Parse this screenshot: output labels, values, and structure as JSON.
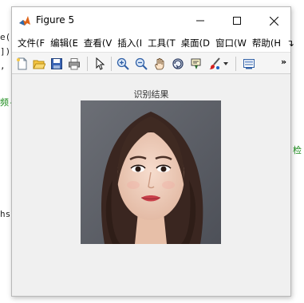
{
  "background_editor": {
    "lines": [
      "e(",
      "]);",
      ",",
      "频-识",
      "hs",
      "检"
    ]
  },
  "window": {
    "title": "Figure 5",
    "buttons": {
      "minimize": "—",
      "maximize": "☐",
      "close": "✕"
    }
  },
  "menu": {
    "items": [
      "文件(F",
      "编辑(E",
      "查看(V",
      "插入(I",
      "工具(T",
      "桌面(D",
      "窗口(W",
      "帮助(H",
      "↴"
    ]
  },
  "toolbar": {
    "more": "»",
    "icons": [
      "new-figure-icon",
      "open-file-icon",
      "save-icon",
      "print-icon",
      "pointer-icon",
      "zoom-in-icon",
      "zoom-out-icon",
      "pan-hand-icon",
      "rotate-3d-icon",
      "data-cursor-icon",
      "brush-icon",
      "brush-dropdown-icon",
      "link-plot-icon"
    ]
  },
  "figure": {
    "axes_title": "识别结果"
  },
  "colors": {
    "window_bg": "#f0f0f0",
    "green_text": "#1a8a1a"
  }
}
